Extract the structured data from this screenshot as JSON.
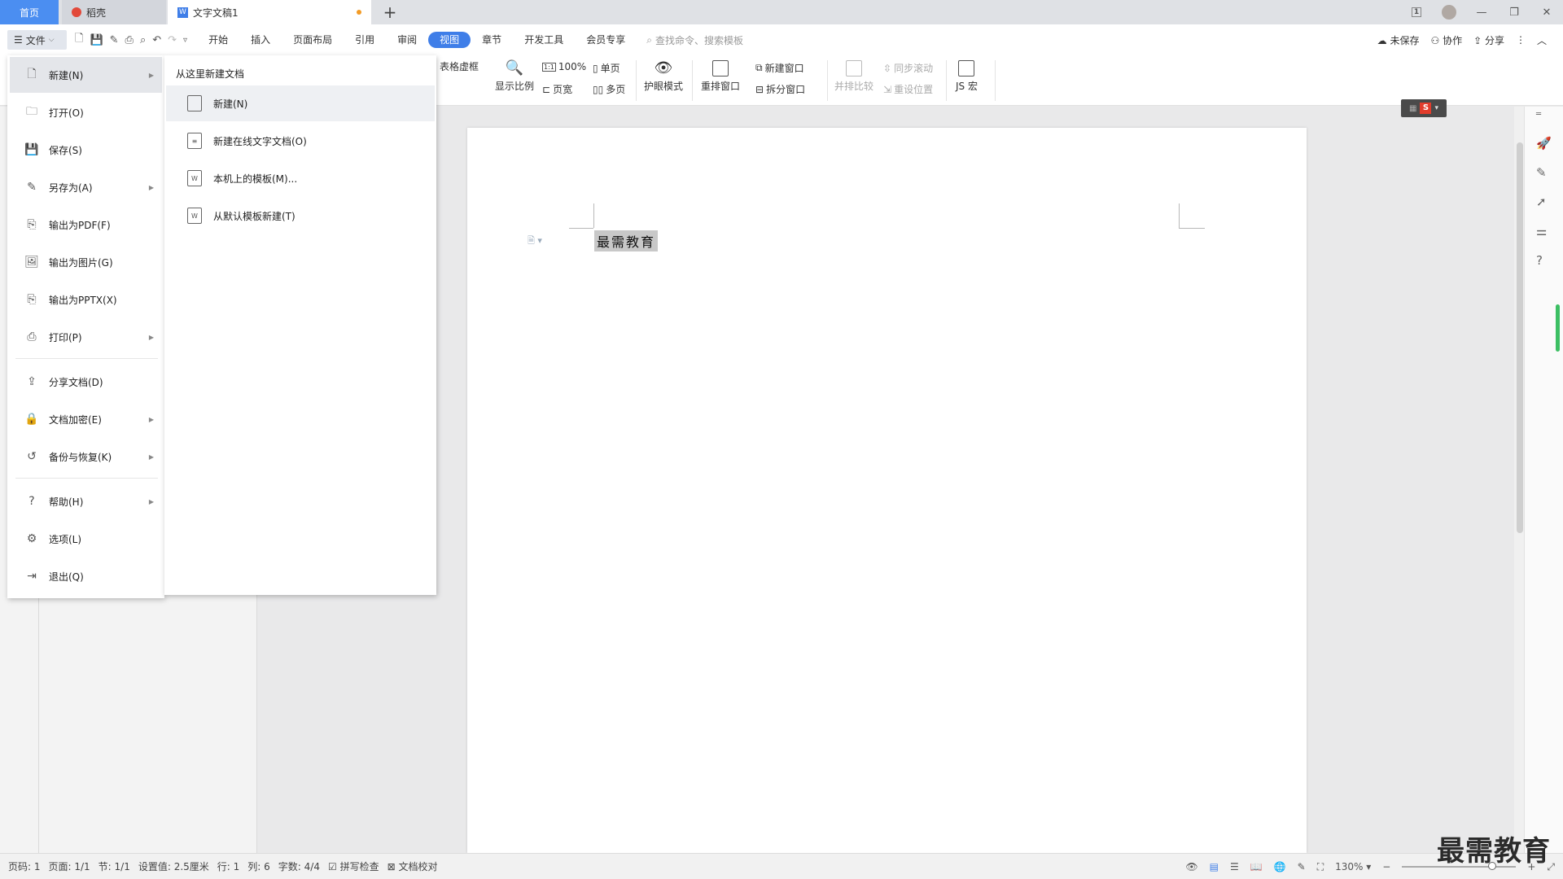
{
  "tabs": {
    "home": "首页",
    "daoke": "稻壳",
    "document": "文字文稿1",
    "add": "+"
  },
  "window": {
    "badge": "1",
    "minimize": "—",
    "restore": "❐",
    "close": "✕"
  },
  "menubar": {
    "file_label": "文件",
    "tabs": [
      "开始",
      "插入",
      "页面布局",
      "引用",
      "审阅",
      "视图",
      "章节",
      "开发工具",
      "会员专享"
    ],
    "active_tab": "视图",
    "search_placeholder": "查找命令、搜索模板",
    "unsaved": "未保存",
    "collaborate": "协作",
    "share": "分享"
  },
  "ribbon": {
    "table_gridlines": "表格虚框",
    "zoom_label": "显示比例",
    "zoom_100": "100%",
    "page_width": "页宽",
    "single_page": "单页",
    "multi_page": "多页",
    "eye_mode": "护眼模式",
    "arrange_window": "重排窗口",
    "new_window": "新建窗口",
    "split_window": "拆分窗口",
    "side_by_side": "并排比较",
    "sync_scroll": "同步滚动",
    "reset_position": "重设位置",
    "js_macro": "JS 宏"
  },
  "file_menu": {
    "items": [
      {
        "label": "新建(N)",
        "icon": "new-doc-icon",
        "arrow": true
      },
      {
        "label": "打开(O)",
        "icon": "folder-icon",
        "arrow": false
      },
      {
        "label": "保存(S)",
        "icon": "save-icon",
        "arrow": false
      },
      {
        "label": "另存为(A)",
        "icon": "save-as-icon",
        "arrow": true
      },
      {
        "label": "输出为PDF(F)",
        "icon": "pdf-icon",
        "arrow": false
      },
      {
        "label": "输出为图片(G)",
        "icon": "image-icon",
        "arrow": false
      },
      {
        "label": "输出为PPTX(X)",
        "icon": "pptx-icon",
        "arrow": false
      },
      {
        "label": "打印(P)",
        "icon": "print-icon",
        "arrow": true
      },
      {
        "label": "分享文档(D)",
        "icon": "share-icon",
        "arrow": false
      },
      {
        "label": "文档加密(E)",
        "icon": "lock-doc-icon",
        "arrow": true
      },
      {
        "label": "备份与恢复(K)",
        "icon": "backup-icon",
        "arrow": true
      },
      {
        "label": "帮助(H)",
        "icon": "help-icon",
        "arrow": true
      },
      {
        "label": "选项(L)",
        "icon": "gear-icon",
        "arrow": false
      },
      {
        "label": "退出(Q)",
        "icon": "exit-icon",
        "arrow": false
      }
    ]
  },
  "submenu": {
    "title": "从这里新建文档",
    "items": [
      {
        "label": "新建(N)",
        "icon": "new-doc-icon"
      },
      {
        "label": "新建在线文字文档(O)",
        "icon": "online-doc-icon"
      },
      {
        "label": "本机上的模板(M)...",
        "icon": "template-icon"
      },
      {
        "label": "从默认模板新建(T)",
        "icon": "default-template-icon"
      }
    ]
  },
  "document": {
    "text": "最需教育"
  },
  "statusbar": {
    "page_code": "页码: 1",
    "page": "页面: 1/1",
    "section": "节: 1/1",
    "setting": "设置值: 2.5厘米",
    "row": "行: 1",
    "col": "列: 6",
    "word_count": "字数: 4/4",
    "spell_check": "拼写检查",
    "doc_proof": "文档校对",
    "zoom": "130%"
  },
  "watermark": "最需教育",
  "colors": {
    "accent": "#3f7ee8",
    "home_tab": "#4b8ef1",
    "green": "#3cbf63"
  }
}
